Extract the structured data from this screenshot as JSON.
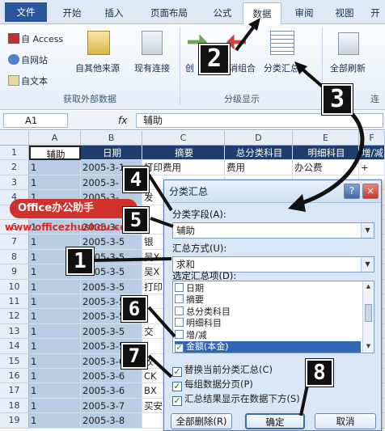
{
  "tabs": [
    "文件",
    "开始",
    "插入",
    "页面布局",
    "公式",
    "数据",
    "审阅",
    "视图",
    "开"
  ],
  "ribbon": {
    "access": "自 Access",
    "web": "自网站",
    "text": "自文本",
    "other_sources": "自其他来源",
    "existing_conn": "现有连接",
    "group_external": "获取外部数据",
    "create": "创",
    "ungroup": "消组合",
    "subtotal": "分类汇总",
    "group_outline": "分级显示",
    "refresh_all": "全部刷新",
    "conn_group": "连"
  },
  "formula_bar": {
    "cell_ref": "A1",
    "fx": "fx",
    "value": "辅助"
  },
  "grid": {
    "columns": [
      "A",
      "B",
      "C",
      "D",
      "E",
      "F"
    ],
    "header_row": [
      "辅助",
      "日期",
      "摘要",
      "总分类科目",
      "明细科目",
      "增/减"
    ],
    "rows": [
      {
        "n": "1",
        "cells": [
          "辅助",
          "日期",
          "摘要",
          "总分类科目",
          "明细科目",
          "增/减"
        ]
      },
      {
        "n": "2",
        "cells": [
          "1",
          "2005-3-1",
          "打印费用",
          "费用",
          "办公费",
          "+"
        ]
      },
      {
        "n": "3",
        "cells": [
          "1",
          "2005-3-",
          "",
          "",
          "",
          ""
        ]
      },
      {
        "n": "4",
        "cells": [
          "1",
          "2005-3-",
          "发",
          "",
          "",
          ""
        ]
      },
      {
        "n": "5",
        "cells": [
          "1",
          "2005-3-",
          "",
          "",
          "",
          ""
        ]
      },
      {
        "n": "6",
        "cells": [
          "1",
          "2005-3-",
          "",
          "",
          "",
          ""
        ]
      },
      {
        "n": "7",
        "cells": [
          "1",
          "2005-3-5",
          "银",
          "",
          "",
          ""
        ]
      },
      {
        "n": "8",
        "cells": [
          "1",
          "2005-3-5",
          "吴X",
          "",
          "",
          ""
        ]
      },
      {
        "n": "9",
        "cells": [
          "1",
          "2005-3-5",
          "吴X",
          "",
          "",
          ""
        ]
      },
      {
        "n": "10",
        "cells": [
          "1",
          "2005-3-5",
          "打印",
          "",
          "",
          ""
        ]
      },
      {
        "n": "11",
        "cells": [
          "1",
          "2005-3-5",
          "",
          "",
          "",
          ""
        ]
      },
      {
        "n": "12",
        "cells": [
          "1",
          "2005-3-5",
          "",
          "",
          "",
          ""
        ]
      },
      {
        "n": "13",
        "cells": [
          "1",
          "2005-3-5",
          "交",
          "",
          "",
          ""
        ]
      },
      {
        "n": "14",
        "cells": [
          "1",
          "2005-3-5",
          "",
          "",
          "",
          ""
        ]
      },
      {
        "n": "15",
        "cells": [
          "1",
          "2005-3-6",
          "收",
          "",
          "",
          ""
        ]
      },
      {
        "n": "16",
        "cells": [
          "1",
          "2005-3-6",
          "CK",
          "",
          "",
          ""
        ]
      },
      {
        "n": "17",
        "cells": [
          "1",
          "2005-3-6",
          "BX",
          "",
          "",
          ""
        ]
      },
      {
        "n": "18",
        "cells": [
          "1",
          "2005-3-7",
          "买安",
          "",
          "",
          ""
        ]
      },
      {
        "n": "19",
        "cells": [
          "1",
          "2005-3-8",
          "",
          "",
          "",
          ""
        ]
      }
    ]
  },
  "dialog": {
    "title": "分类汇总",
    "field_label": "分类字段(A):",
    "field_value": "辅助",
    "method_label": "汇总方式(U):",
    "method_value": "求和",
    "items_label": "选定汇总项(D):",
    "items": [
      {
        "label": "日期",
        "checked": false
      },
      {
        "label": "摘要",
        "checked": false
      },
      {
        "label": "总分类科目",
        "checked": false
      },
      {
        "label": "明细科目",
        "checked": false
      },
      {
        "label": "增/减",
        "checked": false
      },
      {
        "label": "金额(本金)",
        "checked": true
      }
    ],
    "opt_replace": "替换当前分类汇总(C)",
    "opt_pagebreak": "每组数据分页(P)",
    "opt_below": "汇总结果显示在数据下方(S)",
    "btn_remove": "全部删除(R)",
    "btn_ok": "确定",
    "btn_cancel": "取消",
    "help": "?",
    "close": "×"
  },
  "badges": [
    "2",
    "3",
    "4",
    "5",
    "1",
    "6",
    "7",
    "8"
  ],
  "logo": "Office办公助手",
  "watermark": "www.officezhushou.com",
  "colors": {
    "file_tab": "#2a5699",
    "selection": "#b8cce4",
    "logo": "#d0312d",
    "check": "#1a7f1a"
  }
}
